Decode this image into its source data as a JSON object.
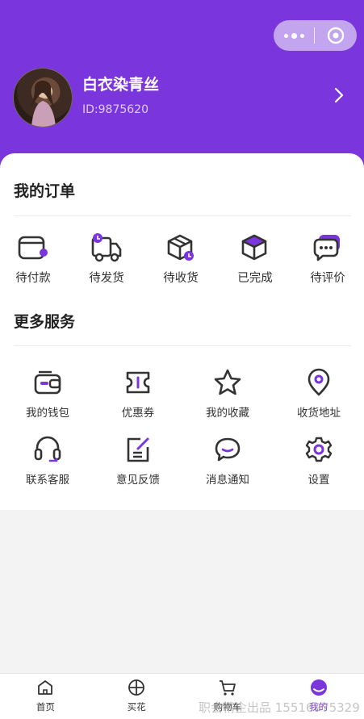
{
  "header": {
    "username": "白衣染青丝",
    "user_id": "ID:9875620"
  },
  "orders": {
    "title": "我的订单",
    "items": [
      {
        "label": "待付款",
        "icon": "wallet-icon"
      },
      {
        "label": "待发货",
        "icon": "truck-icon"
      },
      {
        "label": "待收货",
        "icon": "package-icon"
      },
      {
        "label": "已完成",
        "icon": "box-done-icon"
      },
      {
        "label": "待评价",
        "icon": "comment-icon"
      }
    ]
  },
  "services": {
    "title": "更多服务",
    "items": [
      {
        "label": "我的钱包",
        "icon": "wallet-icon"
      },
      {
        "label": "优惠券",
        "icon": "coupon-icon"
      },
      {
        "label": "我的收藏",
        "icon": "star-icon"
      },
      {
        "label": "收货地址",
        "icon": "location-icon"
      },
      {
        "label": "联系客服",
        "icon": "headset-icon"
      },
      {
        "label": "意见反馈",
        "icon": "feedback-icon"
      },
      {
        "label": "消息通知",
        "icon": "message-icon"
      },
      {
        "label": "设置",
        "icon": "gear-icon"
      }
    ]
  },
  "tabbar": {
    "tabs": [
      {
        "label": "首页",
        "icon": "home-icon"
      },
      {
        "label": "买花",
        "icon": "grid-icon"
      },
      {
        "label": "购物车",
        "icon": "cart-icon"
      },
      {
        "label": "我的",
        "icon": "profile-icon"
      }
    ],
    "active_index": 3
  },
  "watermark": "职会精企出品 15516975329",
  "colors": {
    "accent": "#7a35dc",
    "icon_stroke": "#333333"
  }
}
